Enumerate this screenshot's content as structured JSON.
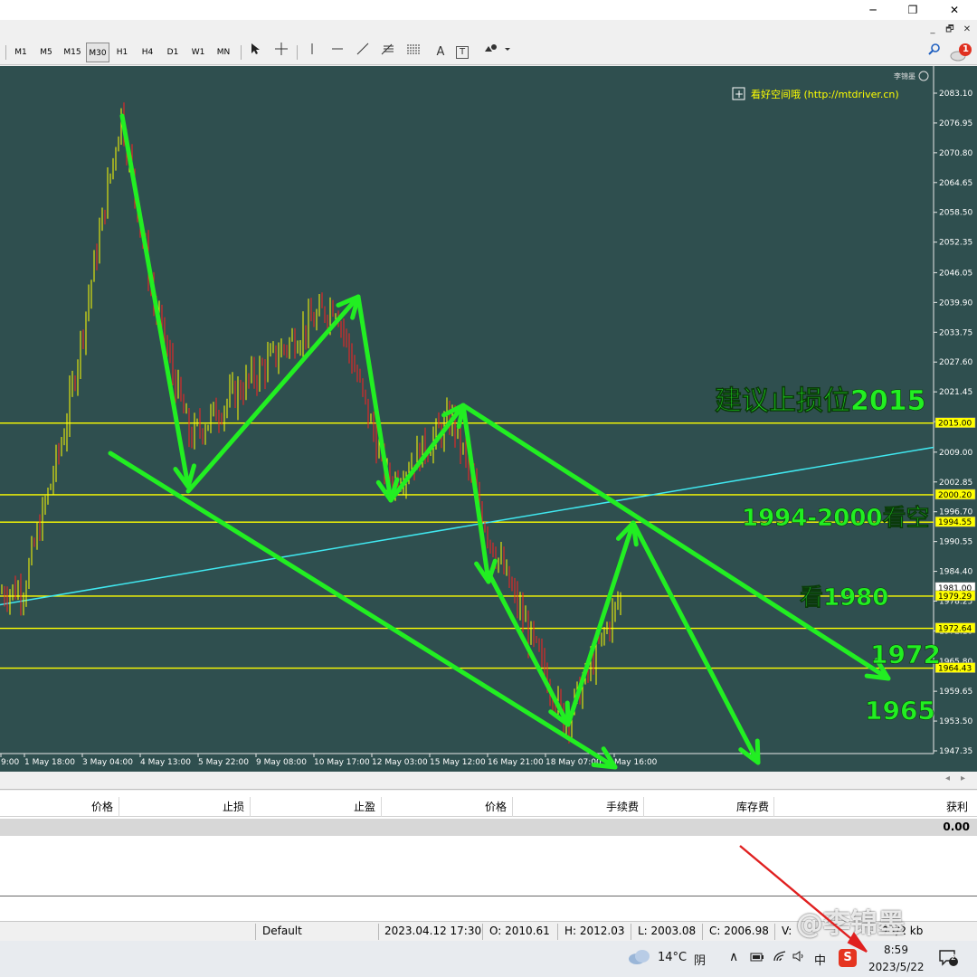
{
  "window": {
    "close_top": "✕",
    "maximize_top": "❐",
    "minimize_top": "─",
    "close_inner": "✕",
    "restore_inner": "🗗",
    "minimize_inner": "_"
  },
  "toolbar": {
    "timeframes": [
      "M1",
      "M5",
      "M15",
      "M30",
      "H1",
      "H4",
      "D1",
      "W1",
      "MN"
    ],
    "active_timeframe": "M30",
    "tools": [
      "cursor-icon",
      "crosshair-icon",
      "vertical-line-icon",
      "horizontal-line-icon",
      "trendline-icon",
      "fibonacci-icon",
      "channel-icon",
      "text-icon",
      "label-icon",
      "shapes-icon"
    ],
    "text_tool": "A",
    "label_tool": "T",
    "notification_count": "1"
  },
  "chart": {
    "corner_label": "李锦墨",
    "indicator_label": "看好空间哦 (http://mtdriver.cn)",
    "indicator_checkbox": "+",
    "colors": {
      "background": "#2f4f4f",
      "levels": "#ffff00",
      "arrows": "#22ee22",
      "trendline": "#40e8f0",
      "candles": "#ffff00",
      "candles_down": "#ff2020"
    },
    "annotations": {
      "stop_loss": "建议止损位2015",
      "short_zone": "1994-2000看空",
      "target_1980": "看1980",
      "target_1972": "1972",
      "target_1965": "1965"
    },
    "price_axis": [
      "2083.10",
      "2076.95",
      "2070.80",
      "2064.65",
      "2058.50",
      "2052.35",
      "2046.05",
      "2039.90",
      "2033.75",
      "2027.60",
      "2021.45",
      "2015.30",
      "2009.00",
      "2002.85",
      "1996.70",
      "1990.55",
      "1984.40",
      "1978.25",
      "1972.10",
      "1965.80",
      "1959.65",
      "1953.50",
      "1947.35"
    ],
    "level_tags": [
      "2015.00",
      "2000.20",
      "1994.55",
      "1981.00",
      "1979.29",
      "1972.64",
      "1964.43"
    ],
    "time_axis": [
      "9:00",
      "1 May 18:00",
      "3 May 04:00",
      "4 May 13:00",
      "5 May 22:00",
      "9 May 08:00",
      "10 May 17:00",
      "12 May 03:00",
      "15 May 12:00",
      "16 May 21:00",
      "18 May 07:00",
      "May 16:00"
    ]
  },
  "terminal": {
    "headers": [
      "价格",
      "止损",
      "止盈",
      "价格",
      "手续费",
      "库存费",
      "获利"
    ],
    "total_profit": "0.00"
  },
  "status": {
    "profile": "Default",
    "datetime": "2023.04.12 17:30",
    "open": "O: 2010.61",
    "high": "H: 2012.03",
    "low": "L: 2003.08",
    "close": "C: 2006.98",
    "volume": "V:",
    "traffic": "74/2 kb"
  },
  "taskbar": {
    "weather_temp": "14°C",
    "weather_cond": "阴",
    "ime": "中",
    "time": "8:59",
    "date": "2023/5/22",
    "notification_count": "2",
    "watermark": "@李锦墨"
  },
  "chart_data": {
    "type": "candlestick",
    "title": "",
    "ylim": [
      1945,
      2086
    ],
    "levels": [
      2015.0,
      2000.2,
      1994.55,
      1979.29,
      1972.64,
      1964.43
    ],
    "close_path": [
      {
        "x": "start",
        "y": 1980
      },
      {
        "x": "1 May 18:00",
        "y": 1981
      },
      {
        "x": "3 May 04:00",
        "y": 2014
      },
      {
        "x": "3 May high",
        "y": 2079
      },
      {
        "x": "4 May 13:00",
        "y": 2040
      },
      {
        "x": "5 May 22:00",
        "y": 2012
      },
      {
        "x": "9 May 08:00",
        "y": 2030
      },
      {
        "x": "10 May 17:00",
        "y": 2040
      },
      {
        "x": "12 May 03:00",
        "y": 2002
      },
      {
        "x": "15 May 12:00",
        "y": 2016
      },
      {
        "x": "16 May 21:00",
        "y": 1992
      },
      {
        "x": "18 May 07:00",
        "y": 1953
      },
      {
        "x": "May 16:00",
        "y": 1980
      }
    ]
  }
}
